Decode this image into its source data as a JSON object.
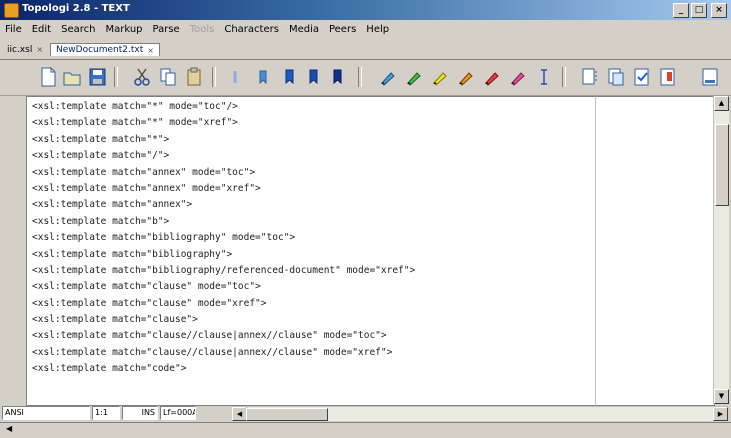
{
  "window": {
    "title": "Topologi 2.8 - TEXT",
    "controls": {
      "minimize": "_",
      "maximize": "□",
      "close": "×"
    }
  },
  "menu": [
    "File",
    "Edit",
    "Search",
    "Markup",
    "Parse",
    "Characters",
    "Media",
    "Peers",
    "Help"
  ],
  "menu_disabled": "Tools",
  "tabs": [
    {
      "label": "iic.xsl",
      "active": false,
      "close": "×"
    },
    {
      "label": "NewDocument2.txt",
      "active": true,
      "close": "×"
    }
  ],
  "toolbar_icons": [
    "new-document-icon",
    "open-folder-icon",
    "save-icon",
    "cut-icon",
    "copy-icon",
    "paste-icon",
    "indent-icon",
    "bookmark-blue-icon",
    "bookmark-add-icon",
    "bookmark-next-icon",
    "bookmark-prev-icon",
    "marker-blue-icon",
    "marker-green-icon",
    "marker-yellow-icon",
    "marker-orange-icon",
    "marker-red-icon",
    "marker-pink-icon",
    "text-cursor-icon",
    "document-split-icon",
    "document-copy-icon",
    "document-check-icon",
    "document-info-icon",
    "panel-icon"
  ],
  "editor": {
    "lines": [
      "<xsl:template match=\"*\" mode=\"toc\"/>",
      "<xsl:template match=\"*\" mode=\"xref\">",
      "<xsl:template match=\"*\">",
      "<xsl:template match=\"/\">",
      "<xsl:template match=\"annex\" mode=\"toc\">",
      "<xsl:template match=\"annex\" mode=\"xref\">",
      "<xsl:template match=\"annex\">",
      "<xsl:template match=\"b\">",
      "<xsl:template match=\"bibliography\" mode=\"toc\">",
      "<xsl:template match=\"bibliography\">",
      "<xsl:template match=\"bibliography/referenced-document\" mode=\"xref\">",
      "<xsl:template match=\"clause\" mode=\"toc\">",
      "<xsl:template match=\"clause\" mode=\"xref\">",
      "<xsl:template match=\"clause\">",
      "<xsl:template match=\"clause//clause|annex//clause\" mode=\"toc\">",
      "<xsl:template match=\"clause//clause|annex//clause\" mode=\"xref\">",
      "<xsl:template match=\"code\">"
    ]
  },
  "status": {
    "encoding": "ANSI",
    "col": "1:1",
    "mode": "INS",
    "line_ending": "Lf=000A"
  }
}
